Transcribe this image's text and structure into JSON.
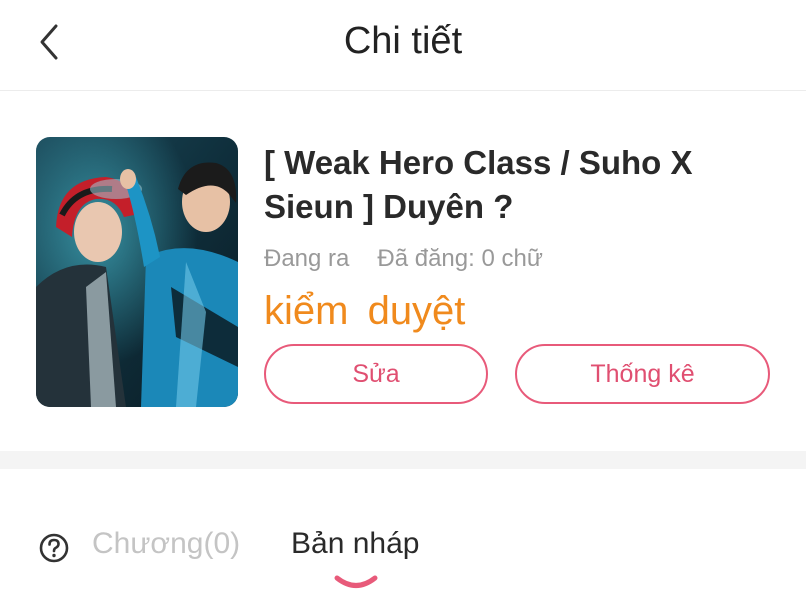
{
  "header": {
    "title": "Chi tiết"
  },
  "story": {
    "title": "[ Weak Hero Class / Suho X Sieun ] Duyên ?",
    "status_label": "Đang ra",
    "word_count_label": "Đã đăng: 0 chữ",
    "review_status": "kiểm duyệt"
  },
  "actions": {
    "edit_label": "Sửa",
    "stats_label": "Thống kê"
  },
  "tabs": {
    "chapters_label": "Chương(0)",
    "drafts_label": "Bản nháp"
  },
  "colors": {
    "accent": "#e85a7a",
    "review": "#f08a1d",
    "muted": "#999999"
  }
}
